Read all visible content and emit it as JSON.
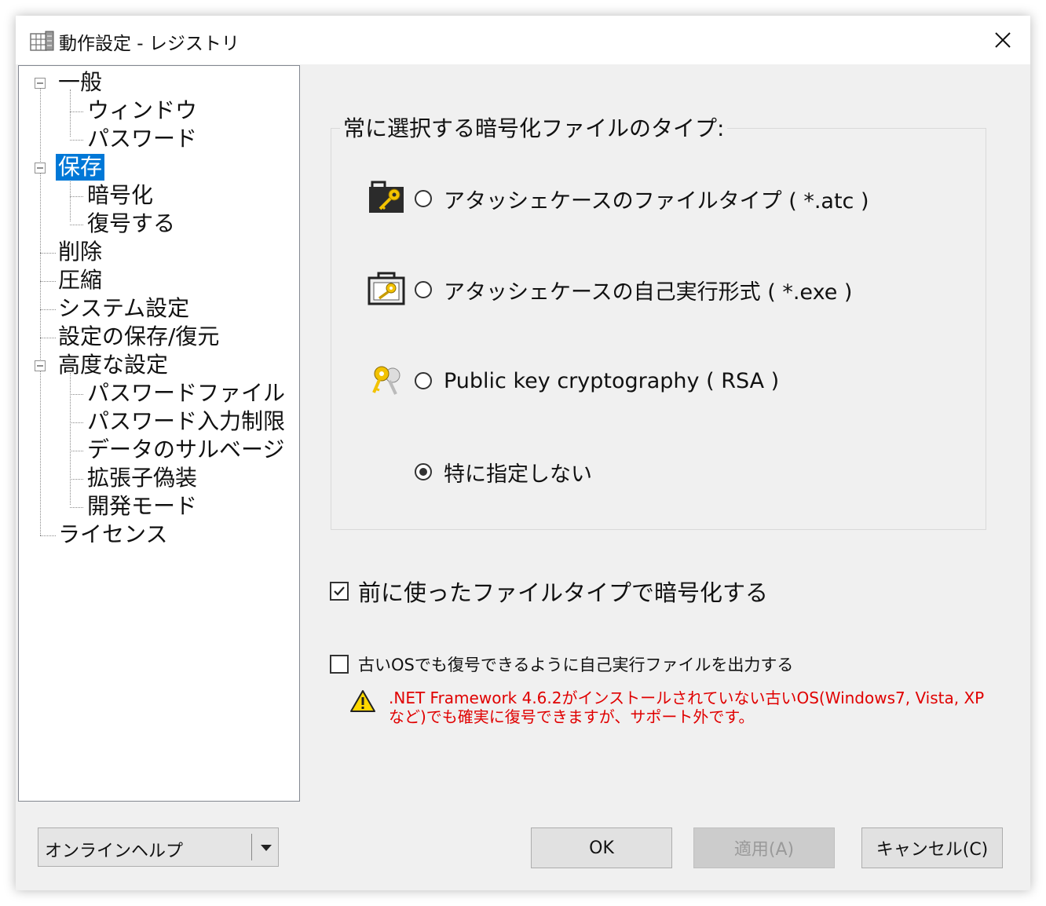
{
  "window": {
    "title": "動作設定 - レジストリ"
  },
  "tree": {
    "items": [
      {
        "label": "一般"
      },
      {
        "label": "ウィンドウ"
      },
      {
        "label": "パスワード"
      },
      {
        "label": "保存",
        "selected": true
      },
      {
        "label": "暗号化"
      },
      {
        "label": "復号する"
      },
      {
        "label": "削除"
      },
      {
        "label": "圧縮"
      },
      {
        "label": "システム設定"
      },
      {
        "label": "設定の保存/復元"
      },
      {
        "label": "高度な設定"
      },
      {
        "label": "パスワードファイル"
      },
      {
        "label": "パスワード入力制限"
      },
      {
        "label": "データのサルベージ"
      },
      {
        "label": "拡張子偽装"
      },
      {
        "label": "開発モード"
      },
      {
        "label": "ライセンス"
      }
    ]
  },
  "filetype_group": {
    "title": "常に選択する暗号化ファイルのタイプ:",
    "options": [
      {
        "label": "アタッシェケースのファイルタイプ ( *.atc )",
        "selected": false,
        "icon": "atc-file-icon"
      },
      {
        "label": "アタッシェケースの自己実行形式 ( *.exe )",
        "selected": false,
        "icon": "exe-file-icon"
      },
      {
        "label": "Public key cryptography ( RSA )",
        "selected": false,
        "icon": "keys-icon"
      },
      {
        "label": "特に指定しない",
        "selected": true
      }
    ]
  },
  "use_previous": {
    "label": "前に使ったファイルタイプで暗号化する",
    "checked": true
  },
  "old_os": {
    "label": "古いOSでも復号できるように自己実行ファイルを出力する",
    "checked": false
  },
  "warning": {
    "text": ".NET Framework 4.6.2がインストールされていない古いOS(Windows7, Vista, XPなど)でも確実に復号できますが、サポート外です。",
    "color": "#e00000"
  },
  "help_dropdown": {
    "label": "オンラインヘルプ"
  },
  "buttons": {
    "ok": "OK",
    "apply": "適用(A)",
    "cancel": "キャンセル(C)"
  },
  "colors": {
    "selection": "#0078d7",
    "background": "#f0f0f0"
  }
}
